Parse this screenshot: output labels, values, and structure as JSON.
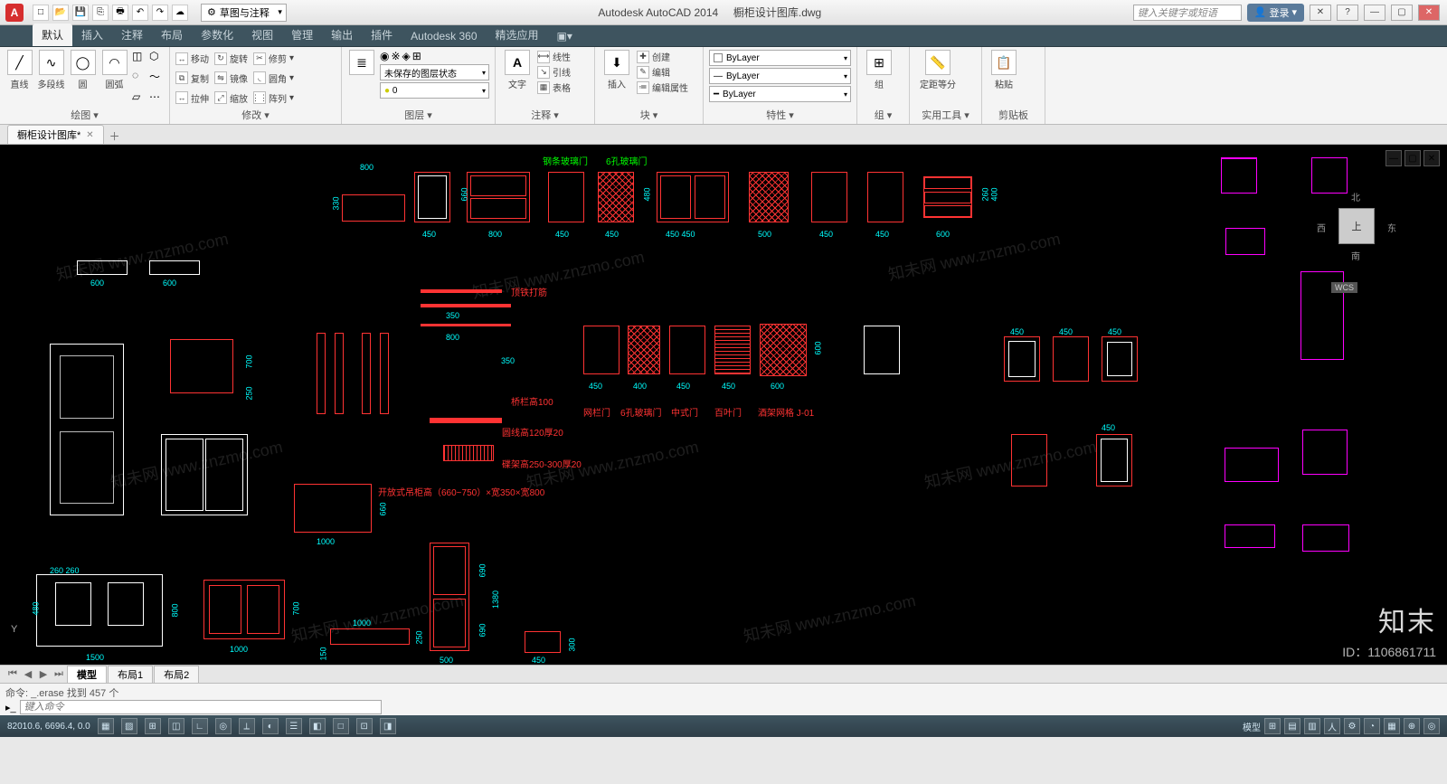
{
  "app": {
    "title": "Autodesk AutoCAD 2014",
    "doc": "橱柜设计图库.dwg",
    "logo": "A"
  },
  "qat": {
    "items": [
      "new",
      "open",
      "save",
      "undo",
      "redo",
      "plot",
      "print",
      "cloud"
    ]
  },
  "workspace": {
    "selected": "草图与注释"
  },
  "search": {
    "placeholder": "键入关键字或短语"
  },
  "login": {
    "label": "登录"
  },
  "window_buttons": {
    "min": "—",
    "max": "▢",
    "close": "✕"
  },
  "ribbon_tabs": [
    "默认",
    "插入",
    "注释",
    "布局",
    "参数化",
    "视图",
    "管理",
    "输出",
    "插件",
    "Autodesk 360",
    "精选应用"
  ],
  "ribbon_active": 0,
  "panels": {
    "draw": {
      "title": "绘图 ▾",
      "big": [
        {
          "label": "直线",
          "icon": "line-icon",
          "glyph": "╱"
        },
        {
          "label": "多段线",
          "icon": "polyline-icon",
          "glyph": "∿"
        },
        {
          "label": "圆",
          "icon": "circle-icon",
          "glyph": "◯"
        },
        {
          "label": "圆弧",
          "icon": "arc-icon",
          "glyph": "◠"
        }
      ],
      "small_glyphs": [
        "◫",
        "⬡",
        "◌",
        "～",
        "▱",
        "⋯"
      ]
    },
    "modify": {
      "title": "修改 ▾",
      "rows": [
        [
          {
            "l": "移动",
            "g": "↔"
          },
          {
            "l": "旋转",
            "g": "↻"
          },
          {
            "l": "修剪",
            "g": "✂"
          }
        ],
        [
          {
            "l": "复制",
            "g": "⧉"
          },
          {
            "l": "镜像",
            "g": "⇋"
          },
          {
            "l": "圆角",
            "g": "◟"
          }
        ],
        [
          {
            "l": "拉伸",
            "g": "↔"
          },
          {
            "l": "缩放",
            "g": "⤢"
          },
          {
            "l": "阵列",
            "g": "⋮⋮"
          }
        ]
      ]
    },
    "layers": {
      "title": "图层 ▾",
      "big_label": "图层特性",
      "current": "未保存的图层状态",
      "sub_glyphs": [
        "◉",
        "※",
        "◈",
        "⊞",
        "◐",
        "◑"
      ]
    },
    "annot": {
      "title": "注释 ▾",
      "big": [
        {
          "l": "文字",
          "g": "A"
        }
      ],
      "rows": [
        {
          "l": "线性",
          "g": "⟷"
        },
        {
          "l": "引线",
          "g": "↘"
        },
        {
          "l": "表格",
          "g": "▦"
        }
      ]
    },
    "block": {
      "title": "块 ▾",
      "big_label": "插入",
      "rows": [
        {
          "l": "创建",
          "g": "✚"
        },
        {
          "l": "编辑",
          "g": "✎"
        },
        {
          "l": "编辑属性",
          "g": "≔"
        }
      ]
    },
    "props": {
      "title": "特性 ▾",
      "color": "ByLayer",
      "line": "ByLayer",
      "lw": "ByLayer"
    },
    "group": {
      "title": "组 ▾",
      "big_label": "组"
    },
    "utils": {
      "title": "实用工具 ▾",
      "big_label": "定距等分"
    },
    "clip": {
      "title": "剪贴板",
      "big_label": "粘贴"
    }
  },
  "file_tabs": {
    "active": "橱柜设计图库*"
  },
  "drawing": {
    "title1": "钢条玻璃门",
    "title2": "6孔玻璃门",
    "row1_dims": [
      "800",
      "450",
      "800",
      "450",
      "450",
      "450  450",
      "500",
      "450",
      "450",
      "600"
    ],
    "row1_h": [
      "330",
      "660",
      "480",
      "260",
      "400"
    ],
    "dims_600a": "600",
    "dims_600b": "600",
    "dims_700": "700",
    "dims_250": "250",
    "dim_350": "350",
    "dim_800b": "800",
    "dim_350b": "350",
    "lbl_top_iron": "顶铁打筋",
    "lbl_rail": "桥栏高100",
    "lbl_round": "圆线高120厚20",
    "lbl_shelf": "碟架高250-300厚20",
    "lbl_open": "开放式吊柜高（660~750）×宽350×宽800",
    "r2_dims": [
      "450",
      "400",
      "450",
      "450",
      "600"
    ],
    "r2_h": "600",
    "r2_labels": [
      "网栏门",
      "6孔玻璃门",
      "中式门",
      "百叶门",
      "酒架网格 J-01"
    ],
    "r3_450": [
      "450",
      "450",
      "450"
    ],
    "r3_450b": "450",
    "dim_1000": "1000",
    "dim_660": "660",
    "bottom_left": {
      "w": "1500",
      "h": "800",
      "h2": "480",
      "top": "260 260"
    },
    "bottom_mid": {
      "w": "1000",
      "h": "700",
      "h2": "150",
      "topw": "1000",
      "toph": "250"
    },
    "bottom_doors": {
      "w": "500",
      "h": "690",
      "h2": "1380",
      "h3": "690",
      "w2": "450",
      "h4": "300"
    },
    "ucs": "Y",
    "viewcube": {
      "face": "上",
      "n": "北",
      "s": "南",
      "e": "东",
      "w": "西",
      "wcs": "WCS"
    }
  },
  "model_tabs": [
    "模型",
    "布局1",
    "布局2"
  ],
  "cmd": {
    "history": "命令: _.erase 找到 457 个",
    "prompt_placeholder": "键入命令"
  },
  "status": {
    "coords": "82010.6, 6696.4, 0.0",
    "toggles": [
      "▦",
      "▨",
      "⊞",
      "◫",
      "∟",
      "◎",
      "⟂",
      "◐",
      "☰",
      "◧",
      "□",
      "⊡",
      "◨"
    ],
    "right": [
      "模型",
      "⊞",
      "▤",
      "▥",
      "人",
      "⚙",
      "◔",
      "▦",
      "⊕",
      "◎"
    ]
  },
  "watermark": {
    "text": "知未网 www.znzmo.com",
    "brand": "知末",
    "id": "ID：1106861711"
  }
}
